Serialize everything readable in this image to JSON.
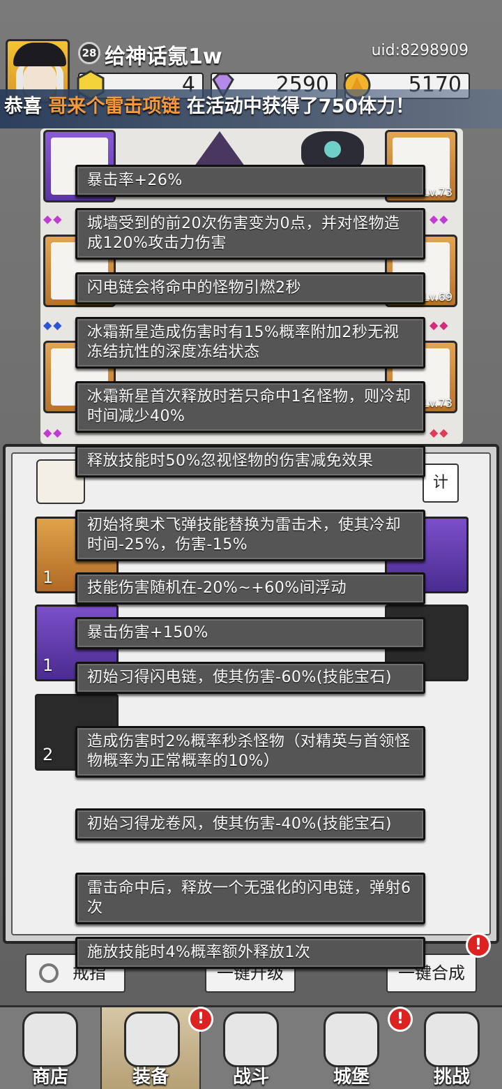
{
  "header": {
    "level": "28",
    "player_name": "给神话氪1w",
    "uid": "uid:8298909",
    "resources": [
      "4",
      "2590",
      "5170"
    ]
  },
  "announcement": {
    "prefix": "恭喜 ",
    "player": "哥来个雷击项链",
    "suffix": " 在活动中获得了750体力！"
  },
  "equipment": {
    "levels": [
      "Lv.73",
      "Lv.69",
      "Lv.73"
    ]
  },
  "gem_panel": {
    "stat_button": "计",
    "counts": [
      "1",
      "1",
      "2"
    ]
  },
  "tooltips": [
    "暴击率+26%",
    "城墙受到的前20次伤害变为0点，并对怪物造成120%攻击力伤害",
    "闪电链会将命中的怪物引燃2秒",
    "冰霜新星造成伤害时有15%概率附加2秒无视冻结抗性的深度冻结状态",
    "冰霜新星首次释放时若只命中1名怪物，则冷却时间减少40%",
    "释放技能时50%忽视怪物的伤害减免效果",
    "初始将奥术飞弹技能替换为雷击术，使其冷却时间-25%，伤害-15%",
    "技能伤害随机在-20%~+60%间浮动",
    "暴击伤害+150%",
    "初始习得闪电链，使其伤害-60%(技能宝石)",
    "造成伤害时2%概率秒杀怪物（对精英与首领怪物概率为正常概率的10%）",
    "初始习得龙卷风，使其伤害-40%(技能宝石)",
    "雷击命中后，释放一个无强化的闪电链，弹射6次",
    "施放技能时4%概率额外释放1次"
  ],
  "actions": {
    "ring_label": "戒指",
    "upgrade_label": "一键升级",
    "merge_label": "一键合成",
    "badge": "!"
  },
  "nav": {
    "items": [
      "商店",
      "装备",
      "战斗",
      "城堡",
      "挑战"
    ],
    "active": "装备"
  },
  "colors": {
    "highlight": "#f49a3b",
    "tooltip_bg": "#555555",
    "badge_red": "#dd2222"
  }
}
